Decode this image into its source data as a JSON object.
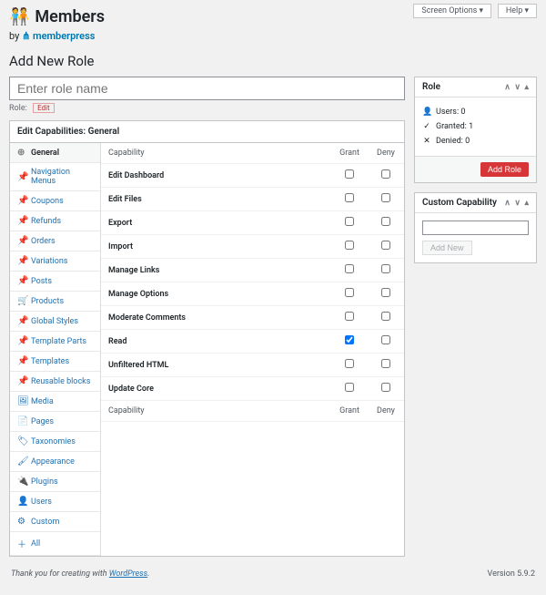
{
  "header": {
    "title": "Members",
    "byline_prefix": "by ",
    "byline_brand": "memberpress"
  },
  "topButtons": {
    "screenOptions": "Screen Options ▾",
    "help": "Help ▾"
  },
  "page": {
    "heading": "Add New Role",
    "roleNamePlaceholder": "Enter role name",
    "roleSlugLabel": "Role:",
    "editBtn": "Edit"
  },
  "capBox": {
    "title": "Edit Capabilities: General",
    "headerCap": "Capability",
    "headerGrant": "Grant",
    "headerDeny": "Deny"
  },
  "tabs": [
    {
      "label": "General",
      "icon": "⊕",
      "active": true
    },
    {
      "label": "Navigation Menus",
      "icon": "📌",
      "active": false
    },
    {
      "label": "Coupons",
      "icon": "📌",
      "active": false
    },
    {
      "label": "Refunds",
      "icon": "📌",
      "active": false
    },
    {
      "label": "Orders",
      "icon": "📌",
      "active": false
    },
    {
      "label": "Variations",
      "icon": "📌",
      "active": false
    },
    {
      "label": "Posts",
      "icon": "📌",
      "active": false
    },
    {
      "label": "Products",
      "icon": "🛒",
      "active": false
    },
    {
      "label": "Global Styles",
      "icon": "📌",
      "active": false
    },
    {
      "label": "Template Parts",
      "icon": "📌",
      "active": false
    },
    {
      "label": "Templates",
      "icon": "📌",
      "active": false
    },
    {
      "label": "Reusable blocks",
      "icon": "📌",
      "active": false
    },
    {
      "label": "Media",
      "icon": "🖼",
      "active": false
    },
    {
      "label": "Pages",
      "icon": "📄",
      "active": false
    },
    {
      "label": "Taxonomies",
      "icon": "🏷",
      "active": false
    },
    {
      "label": "Appearance",
      "icon": "🖌",
      "active": false
    },
    {
      "label": "Plugins",
      "icon": "🔌",
      "active": false
    },
    {
      "label": "Users",
      "icon": "👤",
      "active": false
    },
    {
      "label": "Custom",
      "icon": "⚙",
      "active": false
    },
    {
      "label": "All",
      "icon": "＋",
      "active": false
    }
  ],
  "capabilities": [
    {
      "name": "Edit Dashboard",
      "grant": false,
      "deny": false
    },
    {
      "name": "Edit Files",
      "grant": false,
      "deny": false
    },
    {
      "name": "Export",
      "grant": false,
      "deny": false
    },
    {
      "name": "Import",
      "grant": false,
      "deny": false
    },
    {
      "name": "Manage Links",
      "grant": false,
      "deny": false
    },
    {
      "name": "Manage Options",
      "grant": false,
      "deny": false
    },
    {
      "name": "Moderate Comments",
      "grant": false,
      "deny": false
    },
    {
      "name": "Read",
      "grant": true,
      "deny": false
    },
    {
      "name": "Unfiltered HTML",
      "grant": false,
      "deny": false
    },
    {
      "name": "Update Core",
      "grant": false,
      "deny": false
    }
  ],
  "roleMeta": {
    "title": "Role",
    "users": "Users: 0",
    "granted": "Granted: 1",
    "denied": "Denied: 0",
    "addRole": "Add Role"
  },
  "customCap": {
    "title": "Custom Capability",
    "addNew": "Add New"
  },
  "footer": {
    "thanks_prefix": "Thank you for creating with ",
    "wp": "WordPress",
    "thanks_suffix": ".",
    "version": "Version 5.9.2"
  }
}
